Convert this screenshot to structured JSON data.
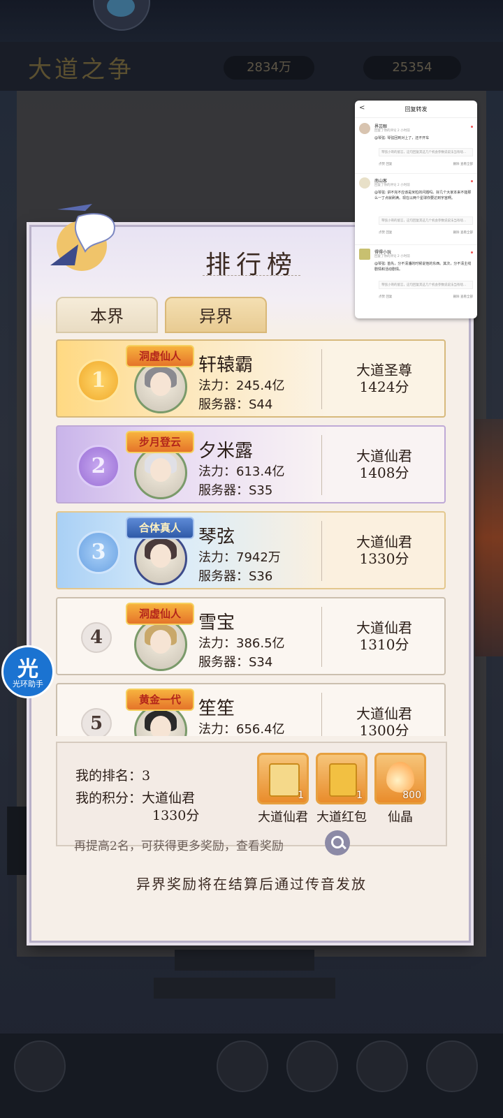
{
  "background": {
    "title": "大道之争",
    "resource_left": "2834万",
    "resource_right": "25354"
  },
  "panel": {
    "title": "排行榜",
    "tabs": {
      "local": "本界",
      "other": "异界"
    }
  },
  "labels": {
    "power": "法力：",
    "server": "服务器："
  },
  "rankings": [
    {
      "rank": "1",
      "badge": "洞虚仙人",
      "name": "轩辕霸",
      "power": "245.4亿",
      "server": "S44",
      "title": "大道圣尊",
      "score": "1424分"
    },
    {
      "rank": "2",
      "badge": "步月登云",
      "name": "夕米露",
      "power": "613.4亿",
      "server": "S35",
      "title": "大道仙君",
      "score": "1408分"
    },
    {
      "rank": "3",
      "badge": "合体真人",
      "name": "琴弦",
      "power": "7942万",
      "server": "S36",
      "title": "大道仙君",
      "score": "1330分"
    },
    {
      "rank": "4",
      "badge": "洞虚仙人",
      "name": "雪宝",
      "power": "386.5亿",
      "server": "S34",
      "title": "大道仙君",
      "score": "1310分"
    },
    {
      "rank": "5",
      "badge": "黄金一代",
      "name": "笙笙",
      "power": "656.4亿",
      "server": "",
      "title": "大道仙君",
      "score": "1300分"
    }
  ],
  "my_rank": {
    "rank_label": "我的排名：",
    "rank_value": "3",
    "score_label": "我的积分：",
    "score_title": "大道仙君",
    "score_value": "1330分",
    "hint": "再提高2名，可获得更多奖励，查看奖励"
  },
  "rewards": [
    {
      "label": "大道仙君",
      "count": "1"
    },
    {
      "label": "大道红包",
      "count": "1"
    },
    {
      "label": "仙晶",
      "count": "800"
    }
  ],
  "footer_note": "异界奖励将在结算后通过传音发放",
  "assistant": {
    "glyph": "光",
    "label": "光环助手"
  },
  "overlay": {
    "title": "回复转发",
    "back": "<",
    "items": [
      {
        "name": "界芸眼",
        "sub": "回复了你的评论 2 小时前",
        "text": "@琴弦: 琴弦回到对上了，还不开车",
        "quote": "琴弦小哥的留言，这句回复其这几个机会参数说说法当有啥...",
        "like": "点赞",
        "reply": "回复",
        "delete": "删除",
        "more": "查看全部"
      },
      {
        "name": "南山客",
        "sub": "回复了你的评论 2 小时前",
        "text": "@琴弦: 讲不完不应该是米粒的问题吗。好几个大家本来不能那么一丁点就刷满。现在以两个星球你要达到宇宙啊。",
        "quote": "琴弦小哥的留言，这句回复其这几个机会参数说说法当有啥...",
        "like": "点赞",
        "reply": "回复",
        "delete": "删除",
        "more": "查看全部"
      },
      {
        "name": "得得小玩",
        "sub": "回复了你的评论 2 小时前",
        "text": "@琴弦: 首先，分不清潘的时候说他的东西。其次，分不清主线剧情和活动剧情。",
        "quote": "琴弦小哥的留言，这句回复其这几个机会参数说说法当有啥...",
        "like": "点赞",
        "reply": "回复",
        "delete": "删除",
        "more": "查看全部"
      }
    ]
  },
  "colors": {
    "panel_bg": "#f6efe8",
    "gold": "#f0a92a",
    "purple": "#9a6fd6",
    "blue": "#6aa2e3",
    "reward_orange": "#e98c2b",
    "assistant_blue": "#1b73d1"
  }
}
